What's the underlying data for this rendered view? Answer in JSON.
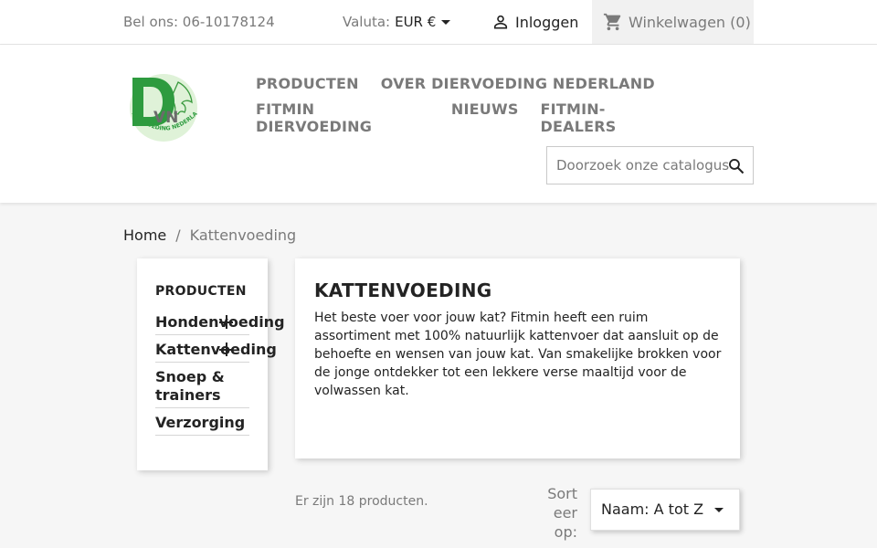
{
  "topbar": {
    "phone": "Bel ons: 06-10178124",
    "currency_label": "Valuta:",
    "currency_value": "EUR €",
    "login": "Inloggen",
    "cart": "Winkelwagen (0)"
  },
  "header": {
    "logo_letters": "DVN",
    "logo_text": "DIERVOEDING NEDERLAND",
    "nav": [
      [
        "PRODUCTEN",
        "OVER DIERVOEDING NEDERLAND"
      ],
      [
        "FITMIN DIERVOEDING",
        "NIEUWS",
        "FITMIN-DEALERS"
      ]
    ],
    "search_placeholder": "Doorzoek onze catalogus"
  },
  "breadcrumb": {
    "home": "Home",
    "separator": "/",
    "current": "Kattenvoeding"
  },
  "sidebar": {
    "title": "PRODUCTEN",
    "items": [
      {
        "label": "Hondenvoeding",
        "expandable": true
      },
      {
        "label": "Kattenvoeding",
        "expandable": true
      },
      {
        "label": "Snoep & trainers",
        "expandable": false
      },
      {
        "label": "Verzorging",
        "expandable": false
      }
    ]
  },
  "category": {
    "title": "KATTENVOEDING",
    "description": "Het beste voer voor jouw kat? Fitmin heeft een ruim assortiment met 100% natuurlijk kattenvoer dat aansluit op de behoefte en wensen van jouw kat. Van smakelijke brokken voor de jonge ontdekker tot een lekkere verse maaltijd voor de volwassen kat."
  },
  "listing": {
    "count_text": "Er zijn 18 producten.",
    "sort_label": "Sort eer op:",
    "sort_value": "Naam: A tot Z"
  },
  "colors": {
    "text": "#232323",
    "muted": "#7a7a7a",
    "logo_green": "#2e9b3f",
    "background": "#f6f6f6"
  }
}
